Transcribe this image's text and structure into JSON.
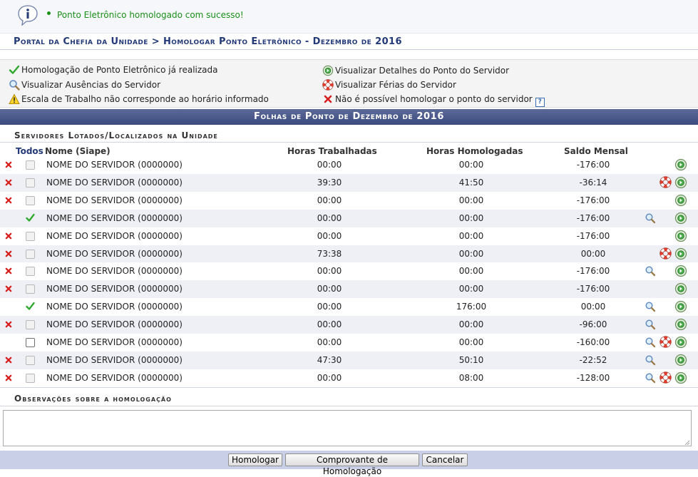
{
  "message": {
    "text": "Ponto Eletrônico homologado com sucesso!"
  },
  "breadcrumb": "Portal da Chefia da Unidade > Homologar Ponto Eletrônico - Dezembro de 2016",
  "legend": {
    "homologado": "Homologação de Ponto Eletrônico já realizada",
    "ausencias": "Visualizar Ausências do Servidor",
    "escala": "Escala de Trabalho não corresponde ao horário informado",
    "detalhes": "Visualizar Detalhes do Ponto do Servidor",
    "ferias": "Visualizar Férias do Servidor",
    "nao_homologar": "Não é possível homologar o ponto do servidor",
    "help_label": "?"
  },
  "table": {
    "title": "Folhas de Ponto de Dezembro de 2016",
    "subtitle": "Servidores Lotados/Localizados na Unidade",
    "columns": {
      "todos": "Todos",
      "nome": "Nome (Siape)",
      "horas_trabalhadas": "Horas Trabalhadas",
      "horas_homologadas": "Horas Homologadas",
      "saldo_mensal": "Saldo Mensal"
    },
    "rows": [
      {
        "status": "blocked",
        "name": "NOME DO SERVIDOR (0000000)",
        "worked": "00:00",
        "approved": "00:00",
        "balance": "-176:00",
        "zoom": false,
        "ferias": false
      },
      {
        "status": "blocked",
        "name": "NOME DO SERVIDOR (0000000)",
        "worked": "39:30",
        "approved": "41:50",
        "balance": "-36:14",
        "zoom": false,
        "ferias": true
      },
      {
        "status": "blocked",
        "name": "NOME DO SERVIDOR (0000000)",
        "worked": "00:00",
        "approved": "00:00",
        "balance": "-176:00",
        "zoom": false,
        "ferias": false
      },
      {
        "status": "homologado",
        "name": "NOME DO SERVIDOR (0000000)",
        "worked": "00:00",
        "approved": "00:00",
        "balance": "-176:00",
        "zoom": true,
        "ferias": false
      },
      {
        "status": "blocked",
        "name": "NOME DO SERVIDOR (0000000)",
        "worked": "00:00",
        "approved": "00:00",
        "balance": "-176:00",
        "zoom": false,
        "ferias": false
      },
      {
        "status": "blocked",
        "name": "NOME DO SERVIDOR (0000000)",
        "worked": "73:38",
        "approved": "00:00",
        "balance": "00:00",
        "zoom": false,
        "ferias": true
      },
      {
        "status": "blocked",
        "name": "NOME DO SERVIDOR (0000000)",
        "worked": "00:00",
        "approved": "00:00",
        "balance": "-176:00",
        "zoom": true,
        "ferias": false
      },
      {
        "status": "blocked",
        "name": "NOME DO SERVIDOR (0000000)",
        "worked": "00:00",
        "approved": "00:00",
        "balance": "-176:00",
        "zoom": false,
        "ferias": false
      },
      {
        "status": "homologado",
        "name": "NOME DO SERVIDOR (0000000)",
        "worked": "00:00",
        "approved": "176:00",
        "balance": "00:00",
        "zoom": true,
        "ferias": false
      },
      {
        "status": "blocked",
        "name": "NOME DO SERVIDOR (0000000)",
        "worked": "00:00",
        "approved": "00:00",
        "balance": "-96:00",
        "zoom": true,
        "ferias": false
      },
      {
        "status": "selectable",
        "name": "NOME DO SERVIDOR (0000000)",
        "worked": "00:00",
        "approved": "00:00",
        "balance": "-160:00",
        "zoom": true,
        "ferias": true
      },
      {
        "status": "blocked",
        "name": "NOME DO SERVIDOR (0000000)",
        "worked": "47:30",
        "approved": "50:10",
        "balance": "-22:52",
        "zoom": true,
        "ferias": false
      },
      {
        "status": "blocked",
        "name": "NOME DO SERVIDOR (0000000)",
        "worked": "00:00",
        "approved": "08:00",
        "balance": "-128:00",
        "zoom": true,
        "ferias": true
      }
    ]
  },
  "observacoes": {
    "title": "Observações sobre a homologação",
    "value": ""
  },
  "buttons": {
    "homologar": "Homologar",
    "comprovante": "Comprovante de Homologação",
    "cancelar": "Cancelar"
  },
  "colors": {
    "title_blue": "#233a78",
    "header_bar": "#3b4a7e",
    "success_green": "#1a8f1a",
    "error_red": "#d62020",
    "check_green": "#2fa82f"
  }
}
